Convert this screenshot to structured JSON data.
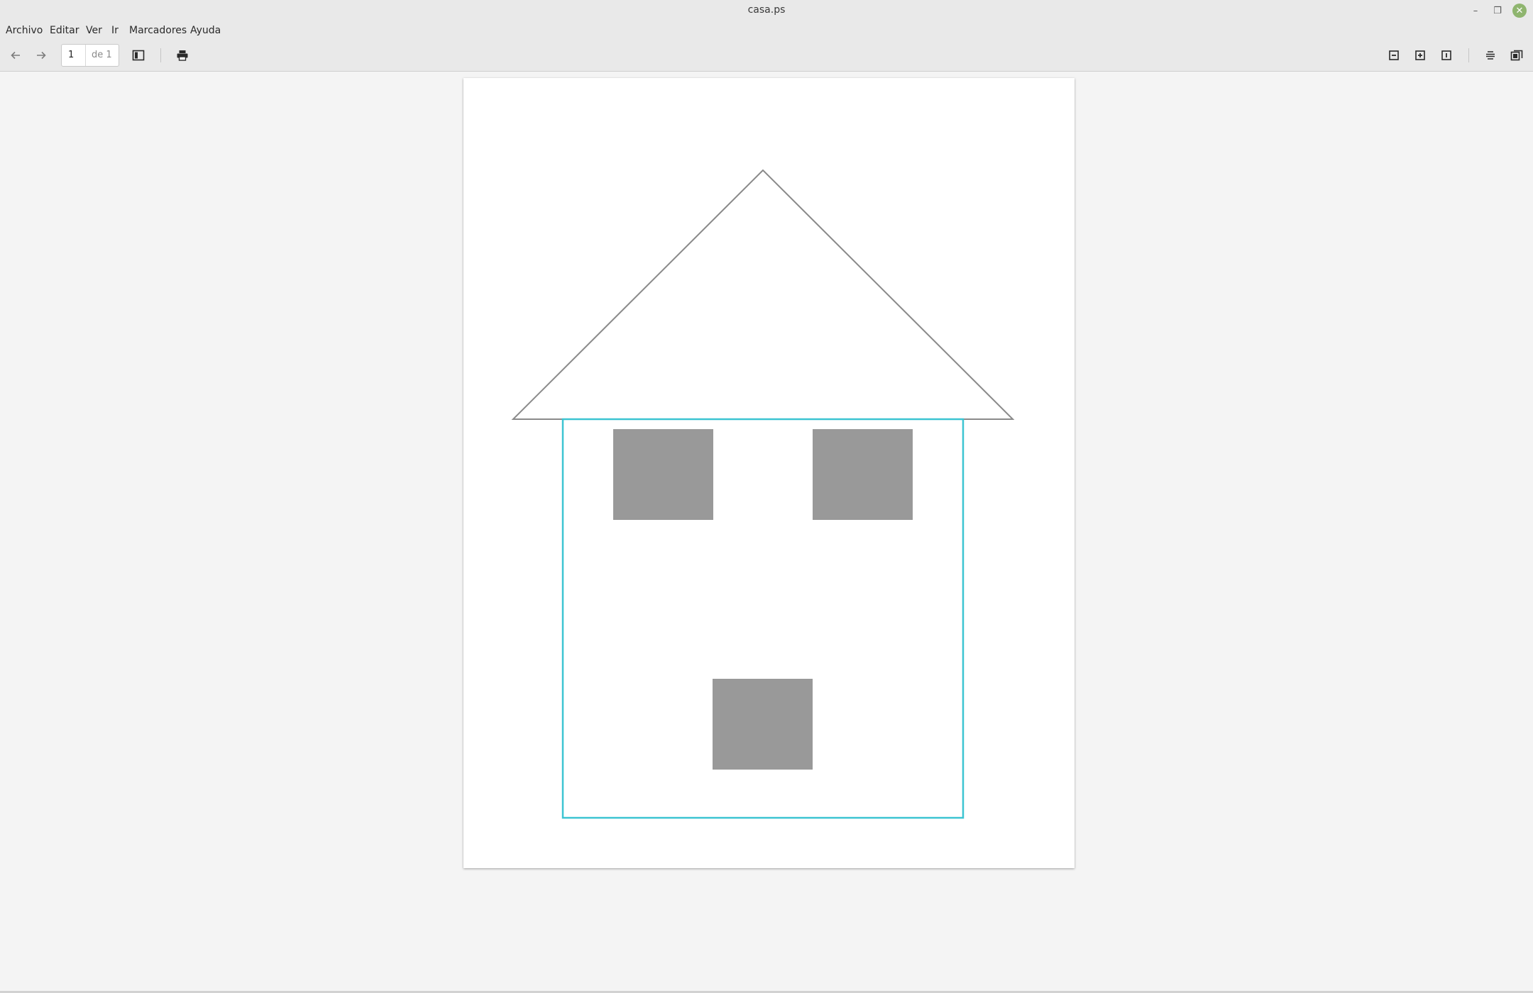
{
  "window": {
    "title": "casa.ps",
    "minimize_glyph": "–",
    "maximize_glyph": "❐",
    "close_glyph": "✕",
    "close_color": "#8fb56f"
  },
  "menubar": {
    "items": [
      {
        "label": "Archivo"
      },
      {
        "label": "Editar"
      },
      {
        "label": "Ver"
      },
      {
        "label": "Ir"
      },
      {
        "label": "Marcadores"
      },
      {
        "label": "Ayuda"
      }
    ]
  },
  "toolbar": {
    "back_icon": "arrow-left-icon",
    "forward_icon": "arrow-right-icon",
    "page_current": "1",
    "page_of": "de 1",
    "sidebar_icon": "sidebar-toggle-icon",
    "print_icon": "printer-icon",
    "zoom_out_icon": "zoom-out-icon",
    "zoom_in_icon": "zoom-in-icon",
    "zoom_fit_icon": "zoom-fit-icon",
    "continuous_icon": "continuous-scroll-icon",
    "dual_page_icon": "dual-page-icon"
  },
  "document": {
    "roof_color": "#8a8a8a",
    "walls_color": "#3cc4d2",
    "window_fill": "#999999",
    "door_fill": "#999999"
  }
}
